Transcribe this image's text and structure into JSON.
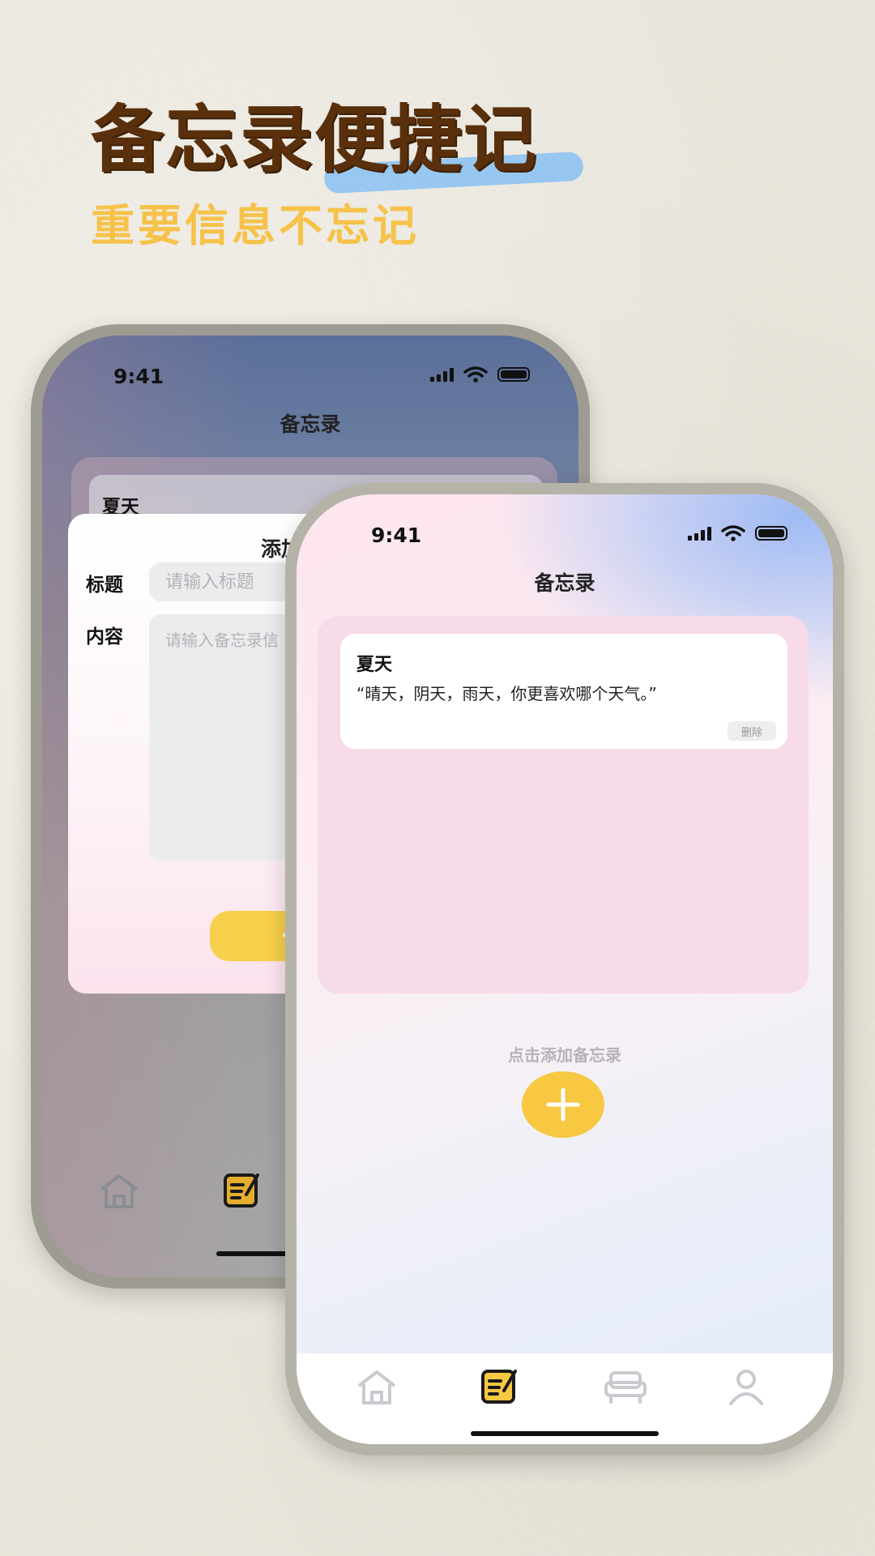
{
  "promo": {
    "headline": "备忘录便捷记",
    "subheadline": "重要信息不忘记"
  },
  "back_phone": {
    "status_time": "9:41",
    "nav_title": "备忘录",
    "note_title": "夏天",
    "dialog": {
      "title": "添加",
      "title_label": "标题",
      "title_placeholder": "请输入标题",
      "content_label": "内容",
      "content_placeholder": "请输入备忘录信",
      "save_label": "保"
    },
    "tabs": [
      "home-icon",
      "note-icon"
    ]
  },
  "front_phone": {
    "status_time": "9:41",
    "nav_title": "备忘录",
    "notes": [
      {
        "title": "夏天",
        "body": "“晴天，阴天，雨天，你更喜欢哪个天气。”",
        "delete_label": "删除"
      }
    ],
    "add_hint": "点击添加备忘录",
    "tabs": [
      "home-icon",
      "note-icon",
      "sofa-icon",
      "profile-icon"
    ],
    "active_tab": "note-icon"
  },
  "colors": {
    "headline": "#5a300c",
    "subheadline": "#f6c24a",
    "accent_yellow": "#f8c843",
    "list_pink": "#f8dbe8",
    "brush_blue": "#8ec3f2"
  }
}
